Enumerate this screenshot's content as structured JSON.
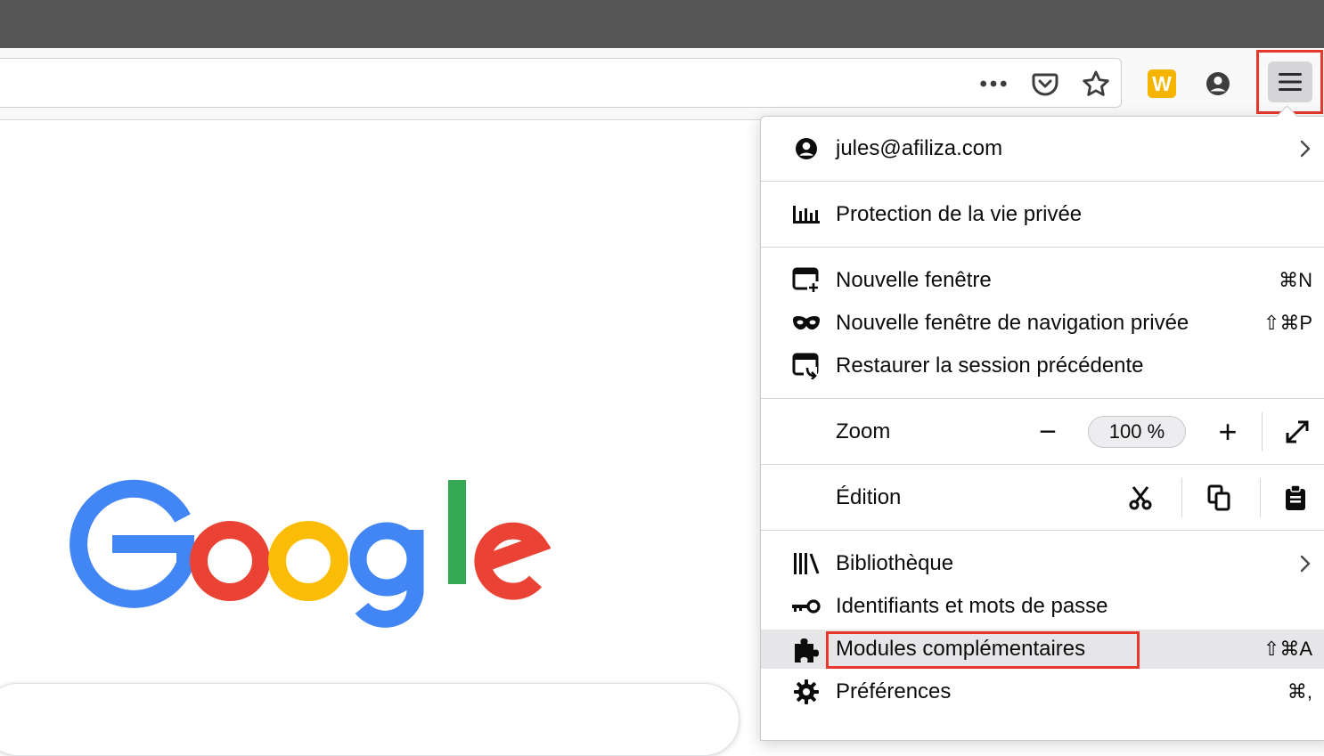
{
  "toolbar": {
    "page_actions_icon": "ellipsis-icon",
    "pocket_icon": "pocket-icon",
    "bookmark_icon": "star-icon",
    "extension_icon_letter": "W",
    "account_icon": "account-icon",
    "menu_icon": "hamburger-icon"
  },
  "page": {
    "logo_colors": {
      "blue": "#4285f4",
      "red": "#ea4335",
      "yellow": "#fbbc05",
      "green": "#34a853"
    }
  },
  "menu": {
    "account": {
      "label": "jules@afiliza.com"
    },
    "privacy": {
      "label": "Protection de la vie privée"
    },
    "new_window": {
      "label": "Nouvelle fenêtre",
      "shortcut": "⌘N"
    },
    "private_window": {
      "label": "Nouvelle fenêtre de navigation privée",
      "shortcut": "⇧⌘P"
    },
    "restore_session": {
      "label": "Restaurer la session précédente"
    },
    "zoom": {
      "label": "Zoom",
      "minus": "−",
      "value": "100 %",
      "plus": "+"
    },
    "edit": {
      "label": "Édition"
    },
    "library": {
      "label": "Bibliothèque"
    },
    "logins": {
      "label": "Identifiants et mots de passe"
    },
    "addons": {
      "label": "Modules complémentaires",
      "shortcut": "⇧⌘A"
    },
    "preferences": {
      "label": "Préférences",
      "shortcut": "⌘,"
    }
  },
  "colors": {
    "highlight_red": "#e8372b",
    "accent_yellow": "#f5b400"
  }
}
